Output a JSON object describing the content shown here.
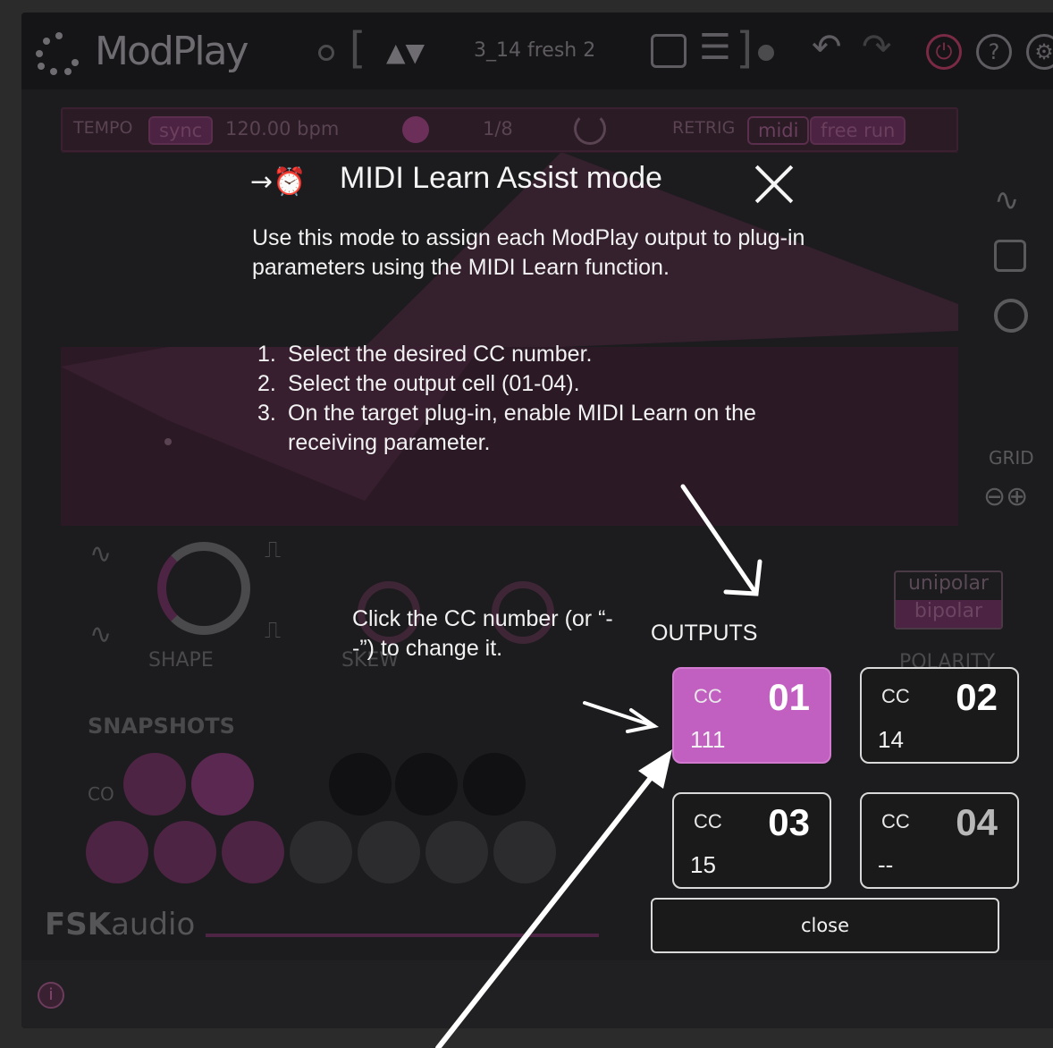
{
  "app": {
    "title": "ModPlay",
    "preset_name": "3_14 fresh 2",
    "preset_arrows": "▲▼"
  },
  "tempo_bar": {
    "tempo_label": "TEMPO",
    "sync_label": "sync",
    "bpm": "120.00 bpm",
    "division": "1/8",
    "retrig_label": "RETRIG",
    "midi_label": "midi",
    "free_run_label": "free run"
  },
  "side_panel": {
    "grid_label": "GRID",
    "polarity_label": "POLARITY",
    "unipolar": "unipolar",
    "bipolar": "bipolar"
  },
  "controls": {
    "shape_label": "SHAPE",
    "skew_label": "SKEW",
    "snapshots_label": "SNAPSHOTS",
    "co_label": "CO",
    "brand_bold": "FSK",
    "brand_light": "audio"
  },
  "overlay": {
    "title": "MIDI Learn Assist mode",
    "description": "Use this mode to assign each ModPlay output to plug-in parameters using the MIDI Learn function.",
    "steps": [
      {
        "num": "1.",
        "text": "Select the desired CC number."
      },
      {
        "num": "2.",
        "text": "Select the output cell (01-04)."
      },
      {
        "num": "3.",
        "text": "On the target plug-in, enable MIDI Learn on the receiving parameter."
      }
    ],
    "hint": "Click the CC number (or “--”) to change it.",
    "outputs_label": "OUTPUTS",
    "cells": [
      {
        "cc_label": "CC",
        "number": "01",
        "value": "111"
      },
      {
        "cc_label": "CC",
        "number": "02",
        "value": "14"
      },
      {
        "cc_label": "CC",
        "number": "03",
        "value": "15"
      },
      {
        "cc_label": "CC",
        "number": "04",
        "value": "--"
      }
    ],
    "close_label": "close"
  },
  "colors": {
    "accent": "#c160c0",
    "background": "#1c1b1d",
    "text": "#f2f2f2"
  },
  "icons": [
    "midi-learn-icon",
    "close-icon",
    "undo-icon",
    "redo-icon",
    "power-icon",
    "help-icon",
    "settings-icon",
    "dice-icon",
    "menu-icon",
    "info-icon"
  ]
}
